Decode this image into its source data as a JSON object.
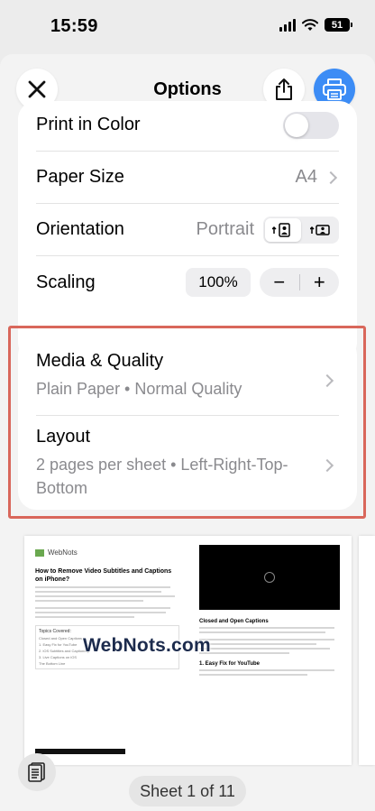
{
  "status_bar": {
    "time": "15:59",
    "battery": "51"
  },
  "header": {
    "title": "Options"
  },
  "options": [
    {
      "label": "Print in Color",
      "control": "toggle",
      "state": false
    },
    {
      "label": "Paper Size",
      "value": "A4"
    },
    {
      "label": "Orientation",
      "value": "Portrait"
    },
    {
      "label": "Scaling",
      "value": "100%",
      "minus": "−",
      "plus": "+"
    }
  ],
  "media_quality": {
    "title": "Media & Quality",
    "subtitle": "Plain Paper • Normal Quality"
  },
  "layout": {
    "title": "Layout",
    "subtitle": "2 pages per sheet • Left-Right-Top-Bottom"
  },
  "preview": {
    "left_page_title": "How to Remove Video Subtitles and Captions on iPhone?",
    "left_page_logo": "WebNots",
    "toc_title": "Topics Covered:",
    "toc_items": [
      "Closed and Open Captions",
      "1. Easy Fix for YouTube",
      "2. iOS Subtitles and Captioning",
      "3. Live Captions on iOS",
      "The Bottom Line"
    ],
    "right_page_heading": "Closed and Open Captions",
    "right_page_subheading": "1. Easy Fix for YouTube",
    "watermark": "WebNots.com",
    "sheet_label": "Sheet 1 of 11"
  },
  "colors": {
    "accent": "#3c8cf5",
    "highlight_border": "#d9675b"
  }
}
